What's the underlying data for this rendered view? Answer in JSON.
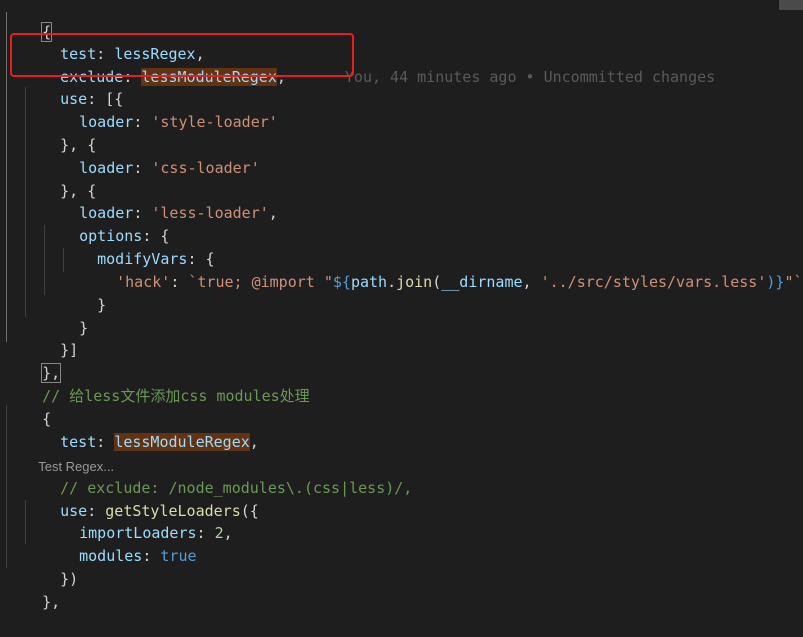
{
  "editor": {
    "lines": {
      "l0": "{",
      "l1_key": "test",
      "l1_val": "lessRegex",
      "l2_key": "exclude",
      "l2_val": "lessModuleRegex",
      "l2_blame": "You, 44 minutes ago • Uncommitted changes",
      "l3_key": "use",
      "l3_punc": "[{",
      "l4_key": "loader",
      "l4_val": "'style-loader'",
      "l5": "}, {",
      "l6_key": "loader",
      "l6_val": "'css-loader'",
      "l7": "}, {",
      "l8_key": "loader",
      "l8_val": "'less-loader'",
      "l9_key": "options",
      "l10_key": "modifyVars",
      "l11_key": "'hack'",
      "l11_tpl_a": "`true; @import \"",
      "l11_tpl_b": "${",
      "l11_obj": "path",
      "l11_fn": "join",
      "l11_arg": "__dirname",
      "l11_str": "'../src/styles/vars.less'",
      "l11_tpl_c": ")}",
      "l11_tpl_d": "\"`",
      "l12": "}",
      "l13": "}",
      "l14": "}]",
      "l15": "},",
      "l16_comment": "// 给less文件添加css modules处理",
      "l17": "{",
      "l18_key": "test",
      "l18_val": "lessModuleRegex",
      "codelens": "Test Regex...",
      "l19_comment": "// exclude: /node_modules\\.(css|less)/,",
      "l20_key": "use",
      "l20_fn": "getStyleLoaders",
      "l21_key": "importLoaders",
      "l21_val": "2",
      "l22_key": "modules",
      "l22_val": "true",
      "l23": "})",
      "l24": "},"
    }
  }
}
